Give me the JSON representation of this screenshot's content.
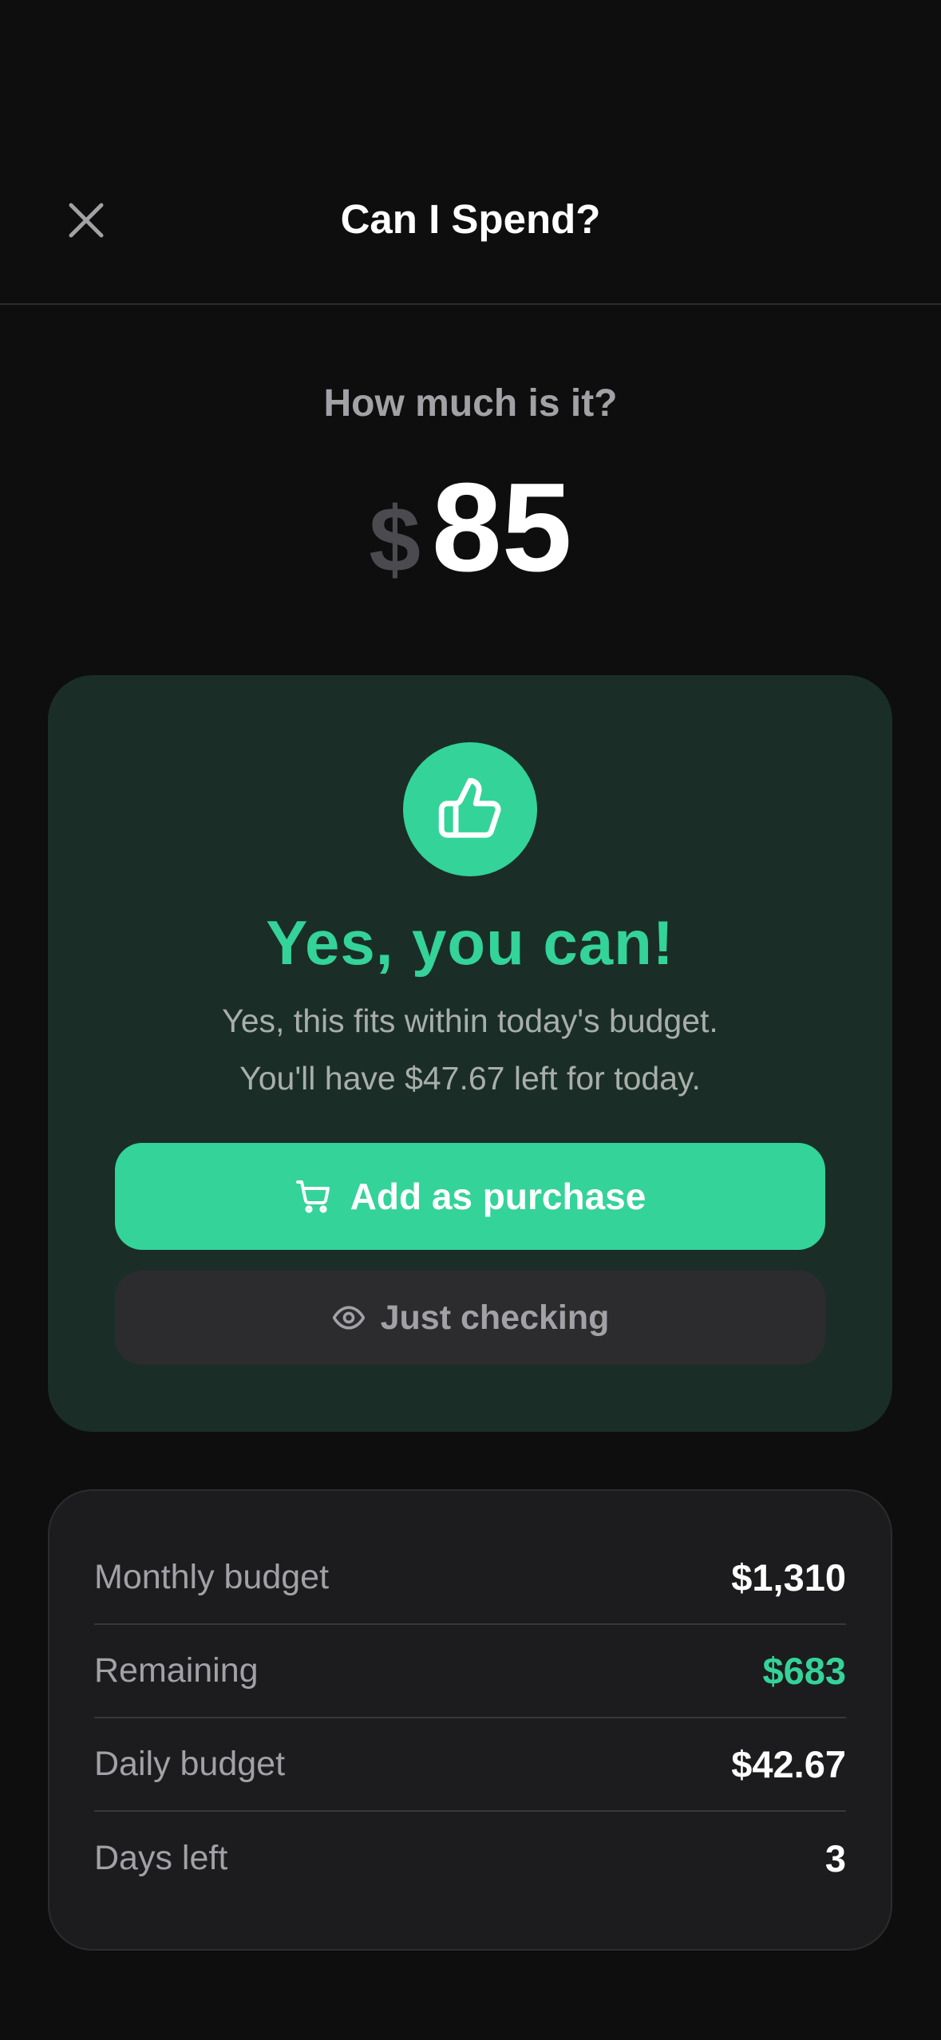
{
  "header": {
    "title": "Can I Spend?",
    "close_icon": "close-icon"
  },
  "amount": {
    "label": "How much is it?",
    "currency": "$",
    "value": "85"
  },
  "result": {
    "icon": "thumbs-up-icon",
    "title": "Yes, you can!",
    "line1": "Yes, this fits within today's budget.",
    "line2": "You'll have $47.67 left for today.",
    "primary_button": {
      "icon": "cart-icon",
      "label": "Add as purchase"
    },
    "secondary_button": {
      "icon": "eye-icon",
      "label": "Just checking"
    }
  },
  "stats": [
    {
      "label": "Monthly budget",
      "value": "$1,310"
    },
    {
      "label": "Remaining",
      "value": "$683"
    },
    {
      "label": "Daily budget",
      "value": "$42.67"
    },
    {
      "label": "Days left",
      "value": "3"
    }
  ],
  "colors": {
    "background": "#0e0e0e",
    "accent": "#34d399",
    "card_positive": "#1a2e27",
    "card_neutral": "#1c1c1e",
    "muted_text": "#a1a1a6"
  }
}
